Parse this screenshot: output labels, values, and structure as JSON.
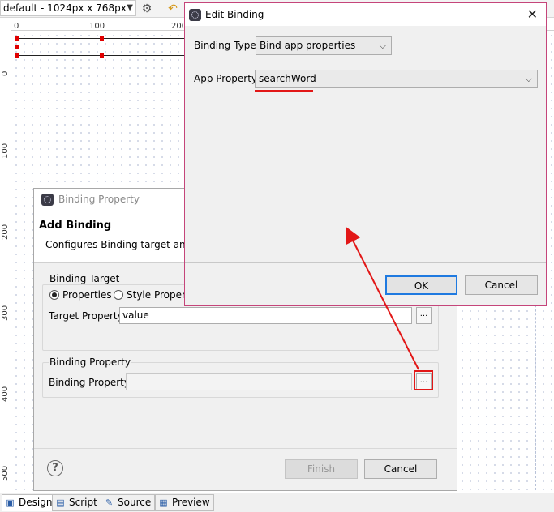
{
  "toolbar": {
    "resolution": "default - 1024px x 768px",
    "icons": [
      "chevron-down-icon",
      "gear-icon",
      "undo-icon"
    ]
  },
  "ruler": {
    "top_labels": [
      "0",
      "100",
      "200"
    ],
    "left_labels": [
      "0",
      "100",
      "200",
      "300",
      "400",
      "500"
    ]
  },
  "bottom_tabs": [
    {
      "label": "Design",
      "icon": "design-icon",
      "active": true
    },
    {
      "label": "Script",
      "icon": "script-icon",
      "active": false
    },
    {
      "label": "Source",
      "icon": "source-icon",
      "active": false
    },
    {
      "label": "Preview",
      "icon": "preview-icon",
      "active": false
    }
  ],
  "binding_property_dialog": {
    "title": "Binding Property",
    "header_title": "Add Binding",
    "header_desc": "Configures Binding target and s",
    "binding_target_group": "Binding Target",
    "radio_properties": "Properties",
    "radio_style": "Style Property",
    "selected_radio": "Properties",
    "target_property_label": "Target Property",
    "target_property_value": "value",
    "binding_property_group": "Binding Property",
    "binding_property_label": "Binding Property",
    "binding_property_value": "",
    "browse_label": "...",
    "finish_label": "Finish",
    "cancel_label": "Cancel",
    "help_label": "?"
  },
  "edit_binding_dialog": {
    "title": "Edit Binding",
    "close_label": "✕",
    "binding_type_label": "Binding Type",
    "binding_type_value": "Bind app properties",
    "app_property_label": "App Property",
    "app_property_value": "searchWord",
    "ok_label": "OK",
    "cancel_label": "Cancel"
  },
  "colors": {
    "annotation": "#e21717",
    "dialog_border": "#c5457a",
    "ok_focus": "#1f7ae0"
  }
}
